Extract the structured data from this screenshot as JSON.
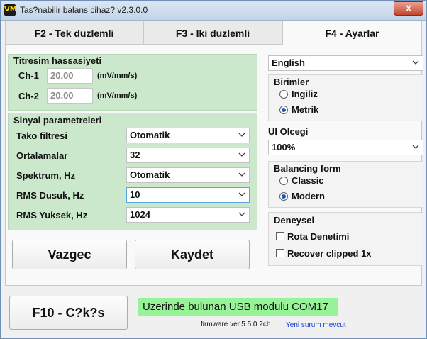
{
  "window": {
    "title": "Tas?nabilir balans cihaz? v2.3.0.0",
    "icon_text": "VM",
    "close_label": "X"
  },
  "tabs": [
    {
      "label": "F2 - Tek duzlemli",
      "active": false
    },
    {
      "label": "F3 - Iki duzlemli",
      "active": false
    },
    {
      "label": "F4 - Ayarlar",
      "active": true
    }
  ],
  "vibration": {
    "title": "Titresim hassasiyeti",
    "ch1": {
      "label": "Ch-1",
      "value": "20.00",
      "unit": "(mV/mm/s)"
    },
    "ch2": {
      "label": "Ch-2",
      "value": "20.00",
      "unit": "(mV/mm/s)"
    }
  },
  "signal": {
    "title": "Sinyal parametreleri",
    "rows": [
      {
        "label": "Tako filtresi",
        "value": "Otomatik"
      },
      {
        "label": "Ortalamalar",
        "value": "32"
      },
      {
        "label": "Spektrum, Hz",
        "value": "Otomatik"
      },
      {
        "label": "RMS Dusuk, Hz",
        "value": "10"
      },
      {
        "label": "RMS Yuksek, Hz",
        "value": "1024"
      }
    ]
  },
  "buttons": {
    "cancel": "Vazgec",
    "save": "Kaydet",
    "exit": "F10 - C?k?s"
  },
  "language": {
    "value": "English"
  },
  "units": {
    "title": "Birimler",
    "options": [
      "Ingiliz",
      "Metrik"
    ],
    "selected": "Metrik"
  },
  "ui_scale": {
    "title": "UI Olcegi",
    "value": "100%"
  },
  "balancing_form": {
    "title": "Balancing form",
    "options": [
      "Classic",
      "Modern"
    ],
    "selected": "Modern"
  },
  "experimental": {
    "title": "Deneysel",
    "items": [
      "Rota Denetimi",
      "Recover clipped 1x"
    ]
  },
  "status": {
    "text": "Uzerinde bulunan USB modulu COM17",
    "firmware": "firmware ver.5.5.0 2ch",
    "update_link": "Yeni surum mevcut"
  }
}
